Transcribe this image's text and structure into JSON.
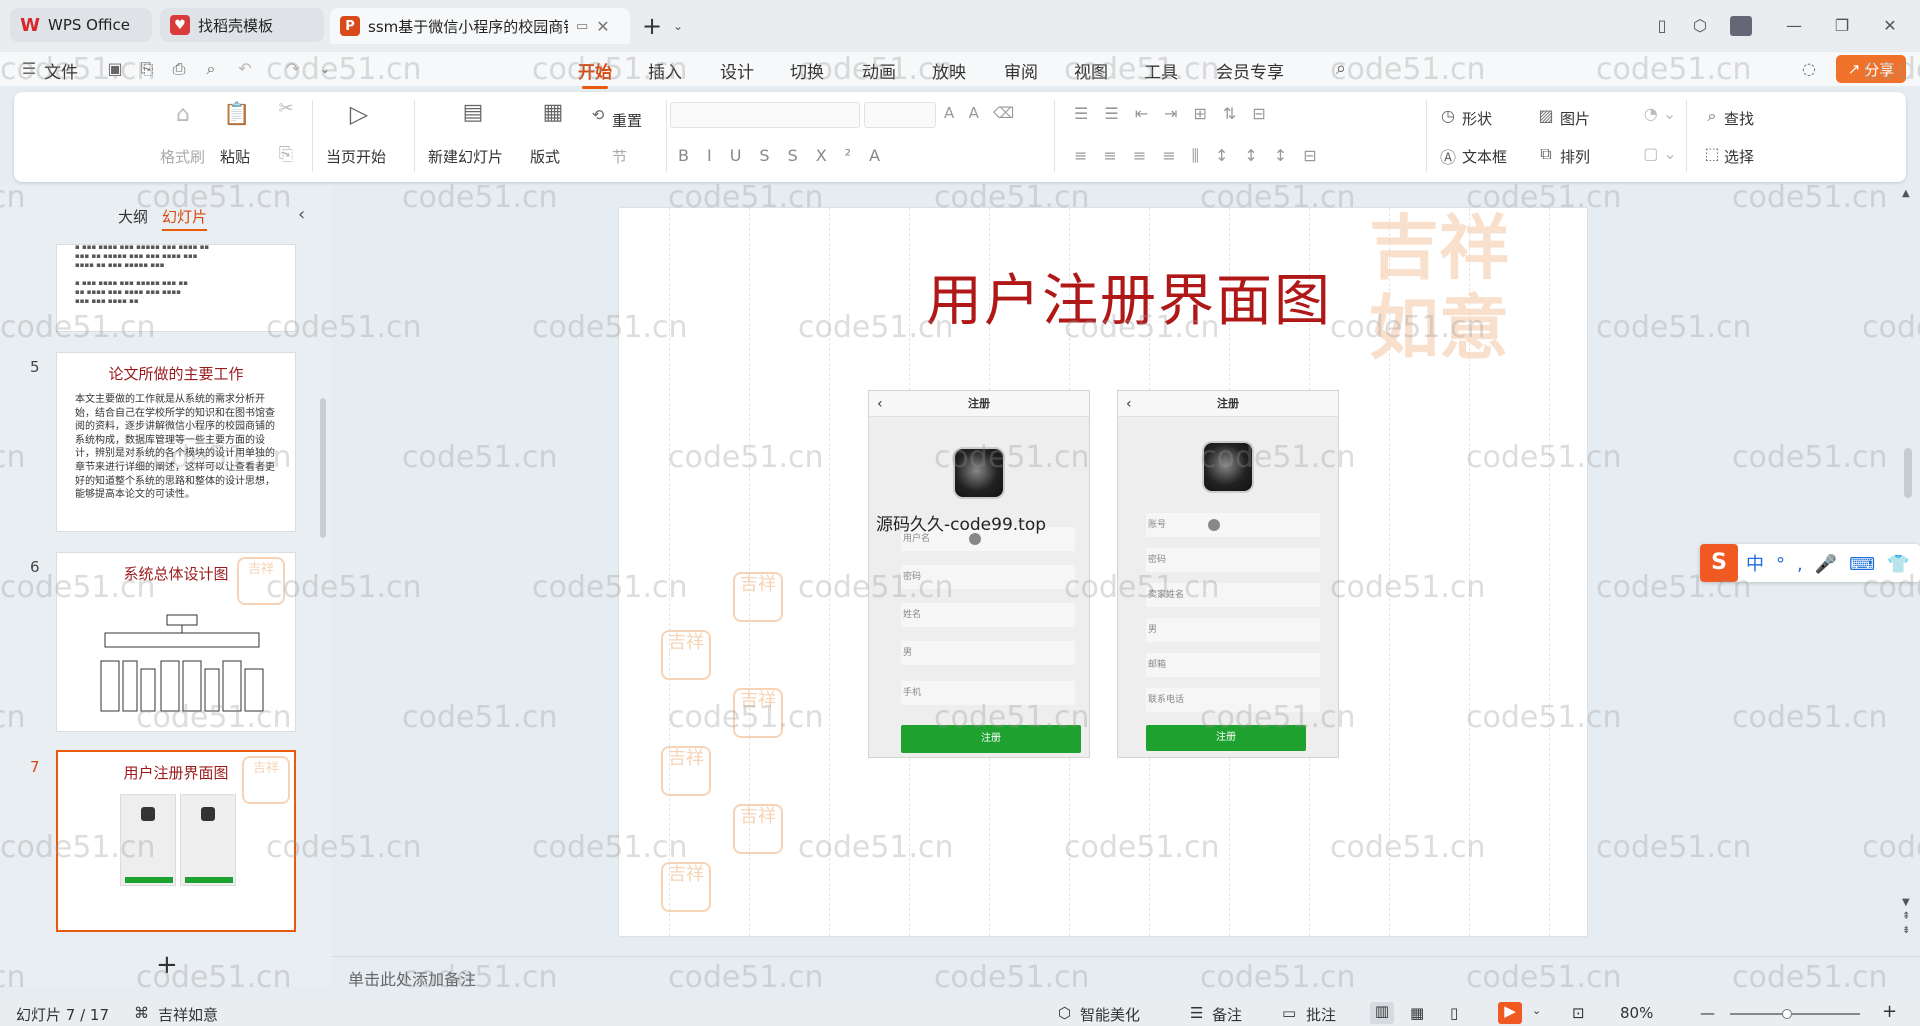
{
  "tabs": [
    {
      "label": "WPS Office"
    },
    {
      "label": "找稻壳模板"
    },
    {
      "label": "ssm基于微信小程序的校园商铺"
    }
  ],
  "menu": {
    "file": "文件",
    "items": [
      "开始",
      "插入",
      "设计",
      "切换",
      "动画",
      "放映",
      "审阅",
      "视图",
      "工具",
      "会员专享"
    ],
    "share": "分享"
  },
  "ribbon": {
    "format_painter": "格式刷",
    "paste": "粘贴",
    "play_from_current": "当页开始",
    "new_slide": "新建幻灯片",
    "layout": "版式",
    "reset": "重置",
    "section": "节",
    "shape": "形状",
    "picture": "图片",
    "find": "查找",
    "textbox": "文本框",
    "arrange": "排列",
    "select": "选择"
  },
  "panel": {
    "tab_outline": "大纲",
    "tab_slides": "幻灯片",
    "add": "+"
  },
  "thumbs": [
    {
      "num": "5",
      "title": "论文所做的主要工作",
      "text": "本文主要做的工作就是从系统的需求分析开始，结合自己在学校所学的知识和在图书馆查阅的资料，逐步讲解微信小程序的校园商铺的系统构成，数据库管理等一些主要方面的设计，辨别是对系统的各个模块的设计用单独的章节来进行详细的阐述，这样可以让查看者更好的知道整个系统的思路和整体的设计思想，能够提高本论文的可读性。"
    },
    {
      "num": "6",
      "title": "系统总体设计图"
    },
    {
      "num": "7",
      "title": "用户注册界面图"
    }
  ],
  "slide": {
    "title": "用户注册界面图",
    "phone1": {
      "header": "注册",
      "fields": [
        "用户名",
        "密码",
        "姓名",
        "男",
        "手机"
      ],
      "button": "注册"
    },
    "phone2": {
      "header": "注册",
      "fields": [
        "账号",
        "密码",
        "卖家姓名",
        "男",
        "邮箱",
        "联系电话"
      ],
      "button": "注册"
    },
    "overlay": "源码久久-code99.top"
  },
  "notes_placeholder": "单击此处添加备注",
  "status": {
    "slide_count": "幻灯片 7 / 17",
    "theme": "吉祥如意",
    "beautify": "智能美化",
    "notes": "备注",
    "comments": "批注",
    "zoom": "80%"
  },
  "watermark": "code51.cn"
}
